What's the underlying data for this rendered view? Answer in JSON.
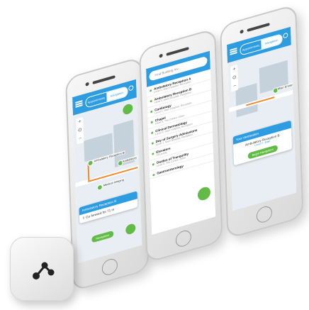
{
  "phone1": {
    "seg_left": "Appointments",
    "seg_right": "Navigation",
    "labels": [
      "Ambulatory Reception B",
      "Ambulatory",
      "Medical Imaging"
    ],
    "card_title": "Ambulatory Reception B",
    "card_step": "Go forward for 71 m",
    "nav_button": "Navigation"
  },
  "phone2": {
    "search_placeholder": "Find Building Inv..",
    "items": [
      {
        "title": "Ambulatory Reception A",
        "sub": "Level 0, Main Hospital, Reception"
      },
      {
        "title": "Ambulatory Reception B",
        "sub": "Level 0, Main Hospital, Reception"
      },
      {
        "title": "Cardiology",
        "sub": "Level 1, Main Hospital, Reception"
      },
      {
        "title": "Chapel",
        "sub": "Level 0, The Centre, Other"
      },
      {
        "title": "Clinical Dermatology",
        "sub": "Level 0, Main Hospital, Reception"
      },
      {
        "title": "Day of Surgery Admissions",
        "sub": "Level 1, Main Hospital, Reception"
      },
      {
        "title": "Elevators",
        "sub": "All Levels"
      },
      {
        "title": "Garden of Tranquility",
        "sub": "Level 0, The Centre, Other"
      },
      {
        "title": "Gastroenterology",
        "sub": ""
      }
    ]
  },
  "phone3": {
    "seg_left": "Appointments",
    "seg_right": "Navigation",
    "labels": [
      "Main Entrance"
    ],
    "card_header": "Your destination",
    "card_title": "Ambulatory Reception B",
    "card_sub": "Level 0 · Main",
    "start_button": "Begin Navigation"
  },
  "colors": {
    "accent": "#2d9ce0",
    "green": "#62bb46",
    "route": "#f08a2c"
  },
  "icons": {
    "app": "share-nodes-icon"
  }
}
